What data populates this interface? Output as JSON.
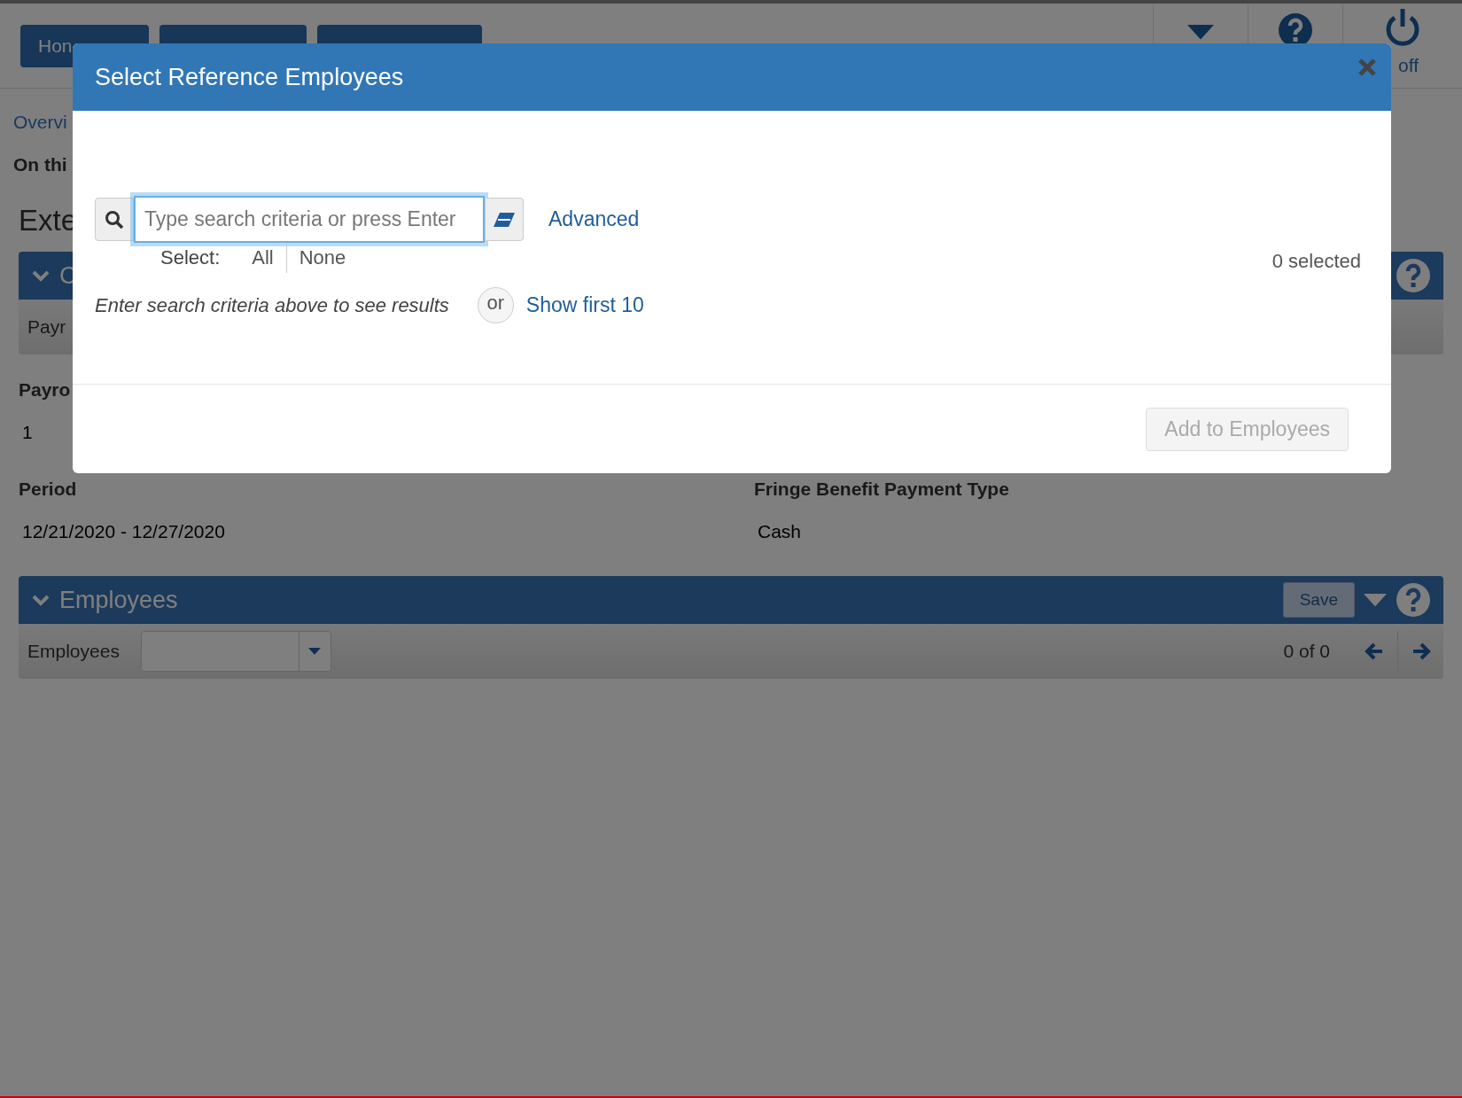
{
  "top_nav": {
    "home_label": "Hon",
    "logoff_label": "off"
  },
  "page": {
    "breadcrumb": "Overvi",
    "intro": "On thi",
    "heading": "Exte",
    "section": {
      "title": "C",
      "expanded": true,
      "subbar_label": "Payr"
    },
    "field_rows": [
      [
        {
          "label": "Payro",
          "value": "1"
        }
      ],
      [
        {
          "label": "Period",
          "value": "12/21/2020 - 12/27/2020"
        },
        {
          "label": "Fringe Benefit Payment Type",
          "value": "Cash"
        }
      ]
    ]
  },
  "employees_panel": {
    "title": "Employees",
    "expanded": true,
    "save_label": "Save",
    "save_disabled": true,
    "filter_label": "Employees",
    "pager": "0 of 0"
  },
  "modal": {
    "title": "Select Reference Employees",
    "search": {
      "placeholder": "Type search criteria or press Enter",
      "focused": true
    },
    "advanced_link": "Advanced",
    "select_label": "Select:",
    "select_options": [
      "All",
      "None"
    ],
    "selected_count": "0 selected",
    "hint": "Enter search criteria above to see results",
    "or_label": "or",
    "show_first_link": "Show first 10",
    "add_button": {
      "label": "Add to Employees",
      "disabled": true
    }
  }
}
